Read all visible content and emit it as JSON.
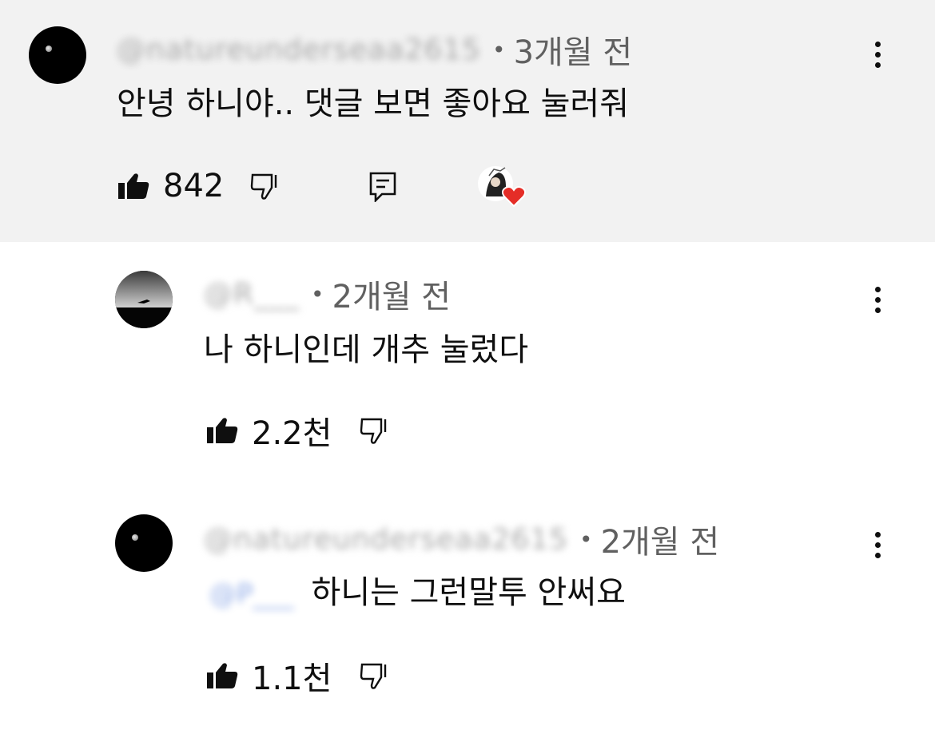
{
  "comments": [
    {
      "username": "@natureunderseaa2615",
      "time": "3개월 전",
      "text": "안녕 하니야.. 댓글 보면 좋아요 눌러줘",
      "likes": "842",
      "has_creator_heart": true
    },
    {
      "username": "@R___",
      "time": "2개월 전",
      "text": "나 하니인데 개추 눌렀다",
      "likes": "2.2천"
    },
    {
      "username": "@natureunderseaa2615",
      "time": "2개월 전",
      "mention": "@P___",
      "text": "하니는 그런말투 안써요",
      "likes": "1.1천"
    }
  ],
  "icons": {
    "like": "thumb-up-filled-icon",
    "dislike": "thumb-down-outline-icon",
    "reply": "reply-icon",
    "more": "more-vert-icon",
    "heart": "creator-heart-icon"
  },
  "colors": {
    "highlight_bg": "#f2f2f2",
    "meta_text": "#606060",
    "heart": "#e52d27"
  }
}
